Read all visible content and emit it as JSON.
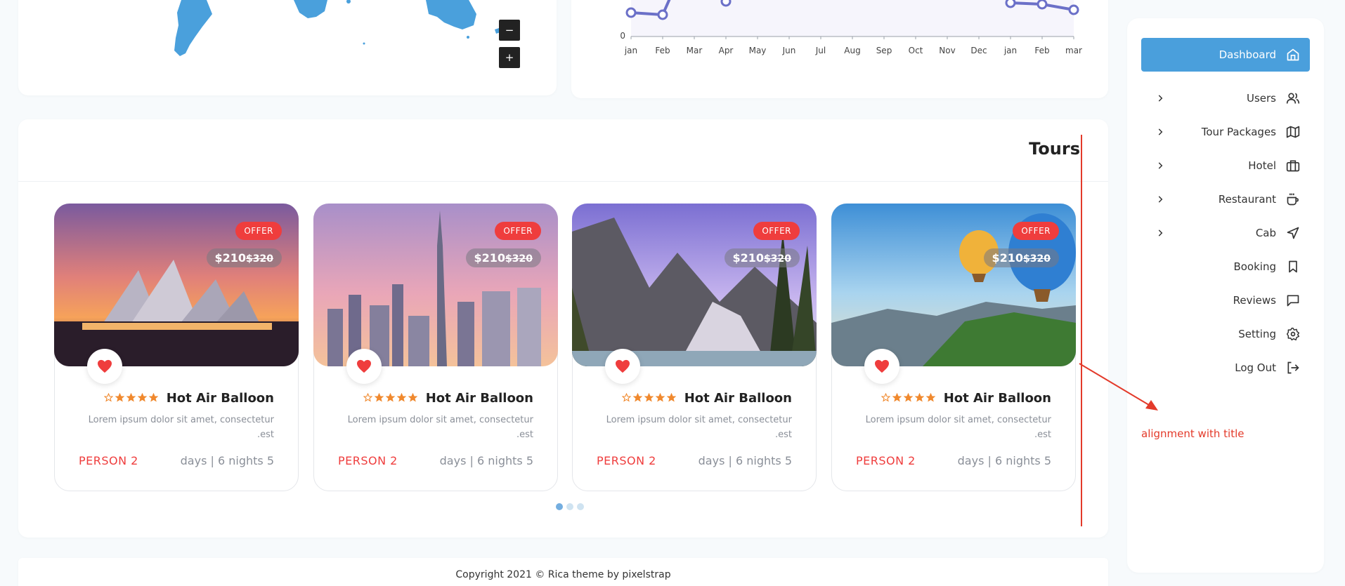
{
  "map": {
    "zoom_out_label": "−",
    "zoom_in_label": "+",
    "color": "#4aa0dc"
  },
  "chart_data": {
    "type": "line",
    "x": [
      "jan",
      "Feb",
      "Mar",
      "Apr",
      "May",
      "Jun",
      "Jul",
      "Aug",
      "Sep",
      "Oct",
      "Nov",
      "Dec",
      "jan",
      "Feb",
      "mar"
    ],
    "ytick": "0",
    "points": [
      {
        "x": "jan",
        "y": 0
      },
      {
        "x": "Feb",
        "y": 0
      },
      {
        "x": "Apr",
        "y": 0
      },
      {
        "x": "jan",
        "y": 0
      },
      {
        "x": "Feb",
        "y": 0
      },
      {
        "x": "mar",
        "y": 0
      }
    ],
    "line_color": "#6b70c8"
  },
  "tours": {
    "title": "Tours",
    "items": [
      {
        "offer": "OFFER",
        "price": "$210",
        "old_price": "$320",
        "name": "Hot Air Balloon",
        "desc": "Lorem ipsum dolor sit amet, consectetur .est",
        "person": "PERSON 2",
        "days": "days | 6 nights 5",
        "rating": 5,
        "image": "opera-house-sunset"
      },
      {
        "offer": "OFFER",
        "price": "$210",
        "old_price": "$320",
        "name": "Hot Air Balloon",
        "desc": "Lorem ipsum dolor sit amet, consectetur .est",
        "person": "PERSON 2",
        "days": "days | 6 nights 5",
        "rating": 5,
        "image": "dubai-skyline"
      },
      {
        "offer": "OFFER",
        "price": "$210",
        "old_price": "$320",
        "name": "Hot Air Balloon",
        "desc": "Lorem ipsum dolor sit amet, consectetur .est",
        "person": "PERSON 2",
        "days": "days | 6 nights 5",
        "rating": 5,
        "image": "mountain-lake"
      },
      {
        "offer": "OFFER",
        "price": "$210",
        "old_price": "$320",
        "name": "Hot Air Balloon",
        "desc": "Lorem ipsum dolor sit amet, consectetur .est",
        "person": "PERSON 2",
        "days": "days | 6 nights 5",
        "rating": 5,
        "image": "hot-air-balloons"
      }
    ],
    "pager_count": 3,
    "pager_active": 0
  },
  "footer": {
    "copyright": "Copyright 2021 © Rica theme by pixelstrap"
  },
  "sidebar": {
    "items": [
      {
        "label": "Dashboard",
        "icon": "home-icon",
        "active": true,
        "has_chevron": false
      },
      {
        "label": "Users",
        "icon": "users-icon",
        "active": false,
        "has_chevron": true
      },
      {
        "label": "Tour Packages",
        "icon": "map-icon",
        "active": false,
        "has_chevron": true
      },
      {
        "label": "Hotel",
        "icon": "briefcase-icon",
        "active": false,
        "has_chevron": true
      },
      {
        "label": "Restaurant",
        "icon": "coffee-icon",
        "active": false,
        "has_chevron": true
      },
      {
        "label": "Cab",
        "icon": "navigation-icon",
        "active": false,
        "has_chevron": true
      },
      {
        "label": "Booking",
        "icon": "bookmark-icon",
        "active": false,
        "has_chevron": false
      },
      {
        "label": "Reviews",
        "icon": "message-square-icon",
        "active": false,
        "has_chevron": false
      },
      {
        "label": "Setting",
        "icon": "settings-icon",
        "active": false,
        "has_chevron": false
      },
      {
        "label": "Log Out",
        "icon": "log-out-icon",
        "active": false,
        "has_chevron": false
      }
    ],
    "accent": "#4a9fdc"
  },
  "annotation": {
    "text": "alignment with title",
    "color": "#e33a2a"
  }
}
